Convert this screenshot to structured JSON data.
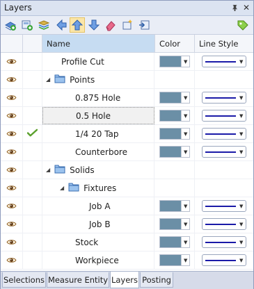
{
  "window": {
    "title": "Layers",
    "pin_glyph": "ᵖ",
    "close_glyph": "✕"
  },
  "toolbar": {
    "icons": [
      "add-layer-icon",
      "add-sublayer-icon",
      "layers-stack-icon",
      "move-left-icon",
      "move-up-icon",
      "move-down-icon",
      "eraser-icon",
      "new-item-icon",
      "import-icon",
      "tag-icon"
    ]
  },
  "table": {
    "headers": {
      "name": "Name",
      "color": "Color",
      "line_style": "Line Style"
    },
    "rows": [
      {
        "name": "Profile Cut",
        "level": 1,
        "type": "item",
        "checked": false,
        "has_props": true
      },
      {
        "name": "Points",
        "level": 0,
        "type": "folder",
        "checked": false,
        "has_props": false
      },
      {
        "name": "0.875 Hole",
        "level": 2,
        "type": "item",
        "checked": false,
        "has_props": true
      },
      {
        "name": "0.5 Hole",
        "level": 2,
        "type": "item",
        "checked": false,
        "has_props": true,
        "selected": true
      },
      {
        "name": "1/4 20 Tap",
        "level": 2,
        "type": "item",
        "checked": true,
        "has_props": true
      },
      {
        "name": "Counterbore",
        "level": 2,
        "type": "item",
        "checked": false,
        "has_props": true
      },
      {
        "name": "Solids",
        "level": 0,
        "type": "folder",
        "checked": false,
        "has_props": false
      },
      {
        "name": "Fixtures",
        "level": 1,
        "type": "folder",
        "checked": false,
        "has_props": false
      },
      {
        "name": "Job A",
        "level": 3,
        "type": "item",
        "checked": false,
        "has_props": true
      },
      {
        "name": "Job B",
        "level": 3,
        "type": "item",
        "checked": false,
        "has_props": true
      },
      {
        "name": "Stock",
        "level": 2,
        "type": "item",
        "checked": false,
        "has_props": true
      },
      {
        "name": "Workpiece",
        "level": 2,
        "type": "item",
        "checked": false,
        "has_props": true
      }
    ]
  },
  "colors": {
    "layer_color": "#6b8fa6",
    "line_color": "#1a1aa8",
    "selection_header": "#c6dcf2",
    "check_green": "#5aa02c"
  },
  "tabs": [
    "Selections",
    "Measure Entity",
    "Layers",
    "Posting"
  ],
  "active_tab": "Layers"
}
